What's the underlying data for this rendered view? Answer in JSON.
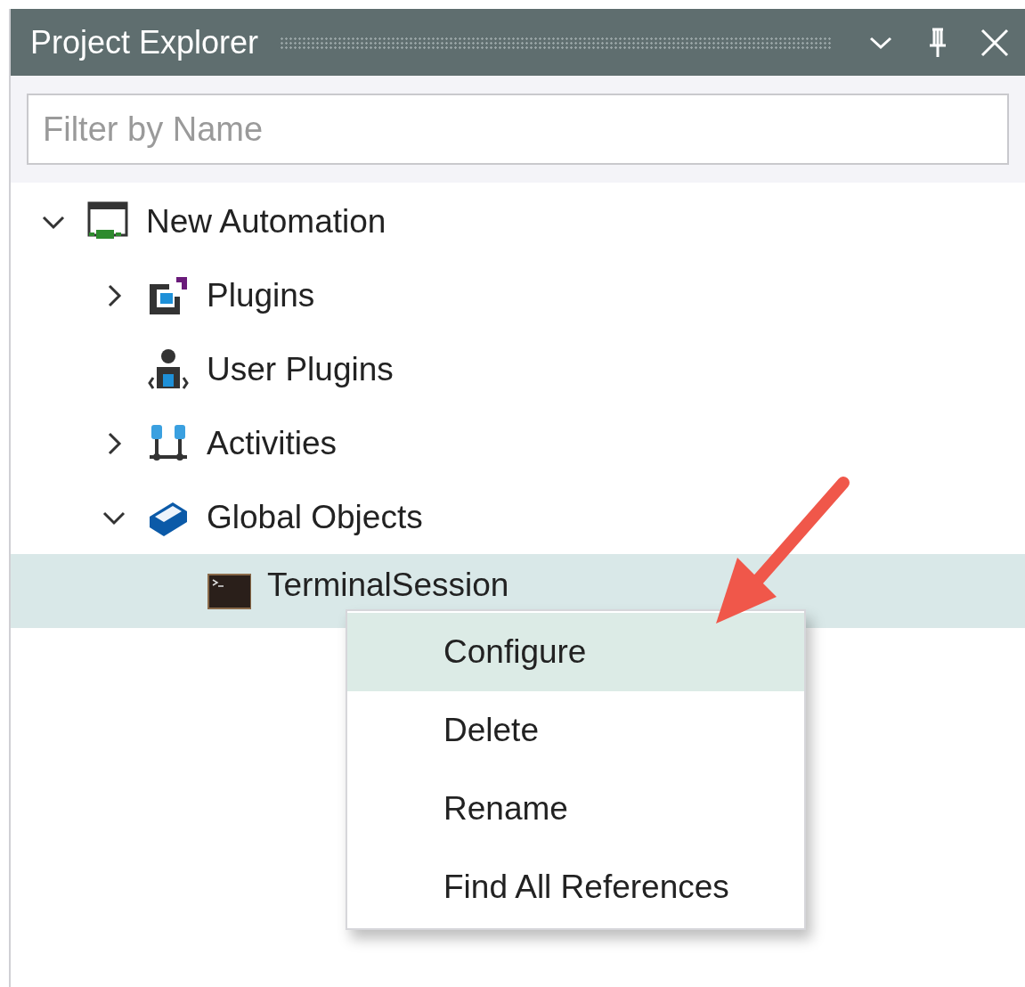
{
  "panel": {
    "title": "Project Explorer"
  },
  "filter": {
    "placeholder": "Filter by Name"
  },
  "tree": [
    {
      "label": "New Automation",
      "kind": "automation",
      "expanded": true,
      "selected": false,
      "children": [
        {
          "label": "Plugins",
          "kind": "plugins",
          "expanded": false,
          "selected": false
        },
        {
          "label": "User Plugins",
          "kind": "userplugins",
          "selected": false
        },
        {
          "label": "Activities",
          "kind": "activities",
          "expanded": false,
          "selected": false
        },
        {
          "label": "Global Objects",
          "kind": "globals",
          "expanded": true,
          "selected": false,
          "children": [
            {
              "label": "TerminalSession",
              "kind": "terminal",
              "selected": true
            }
          ]
        }
      ]
    }
  ],
  "context_menu": [
    {
      "label": "Configure",
      "selected": true
    },
    {
      "label": "Delete",
      "selected": false
    },
    {
      "label": "Rename",
      "selected": false
    },
    {
      "label": "Find All References",
      "selected": false
    }
  ]
}
